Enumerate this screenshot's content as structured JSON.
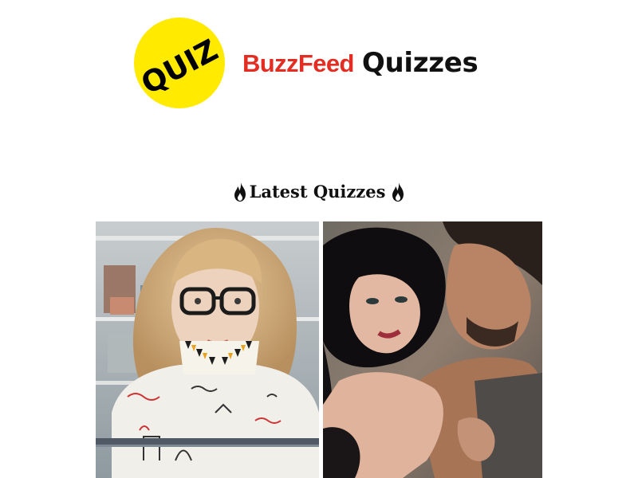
{
  "header": {
    "badge_text": "QUIZ",
    "brand_name": "BuzzFeed",
    "brand_suffix": "Quizzes",
    "colors": {
      "badge": "#ffea00",
      "brand_red": "#e32d22"
    }
  },
  "section": {
    "title": "Latest Quizzes",
    "icon": "fire-icon"
  },
  "quizzes": [
    {
      "image": "woman-glasses-photo"
    },
    {
      "image": "couple-embrace-photo"
    }
  ]
}
